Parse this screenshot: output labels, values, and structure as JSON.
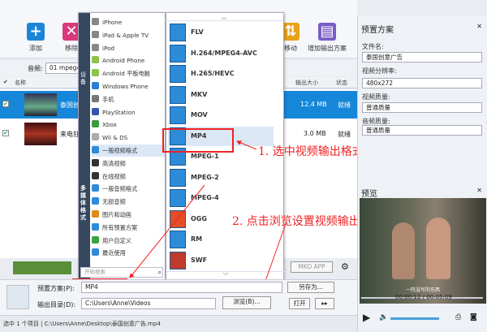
{
  "toolbar": {
    "add_label": "添加",
    "remove_label": "移除",
    "move_label": "移动",
    "add_output_label": "增加输出方案"
  },
  "audio_bar": {
    "label": "音频:",
    "value": "01 mpeg4"
  },
  "list_header": {
    "name": "名称",
    "output_size": "输出大小",
    "status": "状态"
  },
  "files": [
    {
      "name": "泰国创意",
      "size": "12.4 MB",
      "status": "就绪",
      "selected": true
    },
    {
      "name": "来电狂",
      "size": "3.0 MB",
      "status": "就绪",
      "selected": false
    }
  ],
  "categories_side_label": "多媒体格式",
  "categories_top_label": "设备",
  "categories": [
    {
      "label": "iPhone",
      "icon": "apple-icon",
      "color": "#888888"
    },
    {
      "label": "iPad & Apple TV",
      "icon": "apple-icon",
      "color": "#888888"
    },
    {
      "label": "iPod",
      "icon": "apple-icon",
      "color": "#888888"
    },
    {
      "label": "Android Phone",
      "icon": "android-icon",
      "color": "#8cc34a"
    },
    {
      "label": "Android 平板电脑",
      "icon": "android-icon",
      "color": "#8cc34a"
    },
    {
      "label": "Windows Phone",
      "icon": "windows-icon",
      "color": "#2a7fd4"
    },
    {
      "label": "手机",
      "icon": "phone-icon",
      "color": "#777777"
    },
    {
      "label": "PlayStation",
      "icon": "playstation-icon",
      "color": "#3357a8"
    },
    {
      "label": "Xbox",
      "icon": "xbox-icon",
      "color": "#3c9b3c"
    },
    {
      "label": "Wii & DS",
      "icon": "wii-icon",
      "color": "#aaaaaa"
    },
    {
      "label": "一般视频格式",
      "icon": "film-icon",
      "color": "#2e8bd8"
    },
    {
      "label": "高清视频",
      "icon": "hd-icon",
      "color": "#333333"
    },
    {
      "label": "在线视频",
      "icon": "online-icon",
      "color": "#333333"
    },
    {
      "label": "一般音频格式",
      "icon": "audio-icon",
      "color": "#2e8bd8"
    },
    {
      "label": "无损音频",
      "icon": "music-icon",
      "color": "#2e8bd8"
    },
    {
      "label": "图片和动画",
      "icon": "image-icon",
      "color": "#e08a1a"
    },
    {
      "label": "所有预置方案",
      "icon": "grid-icon",
      "color": "#2e8bd8"
    },
    {
      "label": "用户自定义",
      "icon": "user-icon",
      "color": "#3aa33a"
    },
    {
      "label": "最近使用",
      "icon": "clock-icon",
      "color": "#2e8bd8"
    }
  ],
  "search_placeholder": "开始搜索",
  "formats": [
    {
      "label": "FLV",
      "icon_color": "#2e8bd8"
    },
    {
      "label": "H.264/MPEG4-AVC",
      "icon_color": "#2e8bd8"
    },
    {
      "label": "H.265/HEVC",
      "icon_color": "#2e8bd8"
    },
    {
      "label": "MKV",
      "icon_color": "#2e8bd8"
    },
    {
      "label": "MOV",
      "icon_color": "#2e8bd8"
    },
    {
      "label": "MP4",
      "icon_color": "#2e8bd8"
    },
    {
      "label": "MPEG-1",
      "icon_color": "#2e8bd8"
    },
    {
      "label": "MPEG-2",
      "icon_color": "#2e8bd8"
    },
    {
      "label": "MPEG-4",
      "icon_color": "#2e8bd8"
    },
    {
      "label": "OGG",
      "icon_color": "#e44d26"
    },
    {
      "label": "RM",
      "icon_color": "#2e8bd8"
    },
    {
      "label": "SWF",
      "icon_color": "#c0392b"
    }
  ],
  "annotations": {
    "step1": "1. 选中视频输出格式",
    "step2": "2. 点击浏览设置视频输出目录"
  },
  "bottom": {
    "preset_label": "预置方案(P):",
    "preset_value": "MP4",
    "save_as": "另存为...",
    "outdir_label": "输出目录(D):",
    "outdir_value": "C:\\Users\\Anne\\Videos",
    "browse": "浏览(B)...",
    "open": "打开",
    "mux_app": "MKO APP"
  },
  "status_text": "选中 1 个项目 | C:\\Users\\Anne\\Desktop\\泰国创意广告.mp4",
  "right_panel": {
    "title": "预置方案",
    "filename_label": "文件名:",
    "filename_value": "泰国创意广告",
    "resolution_label": "视频分辨率:",
    "resolution_value": "480x272",
    "video_quality_label": "视频质量:",
    "video_quality_value": "普通质量",
    "audio_quality_label": "音频质量:",
    "audio_quality_value": "普通质量",
    "preview_label": "预览",
    "time": "00:00:12 / 00:05:09",
    "subtitle": "一阵没写的东西"
  }
}
